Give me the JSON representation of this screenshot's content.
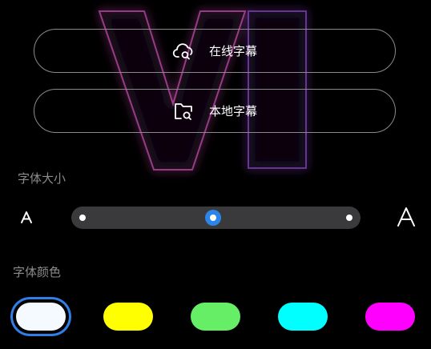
{
  "buttons": {
    "online_subtitles": {
      "label": "在线字幕",
      "icon": "cloud-search-icon"
    },
    "local_subtitles": {
      "label": "本地字幕",
      "icon": "folder-search-icon"
    }
  },
  "font_size": {
    "label": "字体大小",
    "small_icon": "small-a-icon",
    "large_icon": "large-a-icon",
    "value_fraction": 0.49
  },
  "font_color": {
    "label": "字体颜色",
    "options": [
      {
        "name": "white",
        "color": "#f4faff",
        "selected": true
      },
      {
        "name": "yellow",
        "color": "#ffff00",
        "selected": false
      },
      {
        "name": "green",
        "color": "#66ee66",
        "selected": false
      },
      {
        "name": "cyan",
        "color": "#00ffff",
        "selected": false
      },
      {
        "name": "magenta",
        "color": "#ff00ff",
        "selected": false
      }
    ]
  },
  "colors": {
    "background": "#000000",
    "accent": "#2b86e8",
    "track": "#3a3a3c"
  }
}
